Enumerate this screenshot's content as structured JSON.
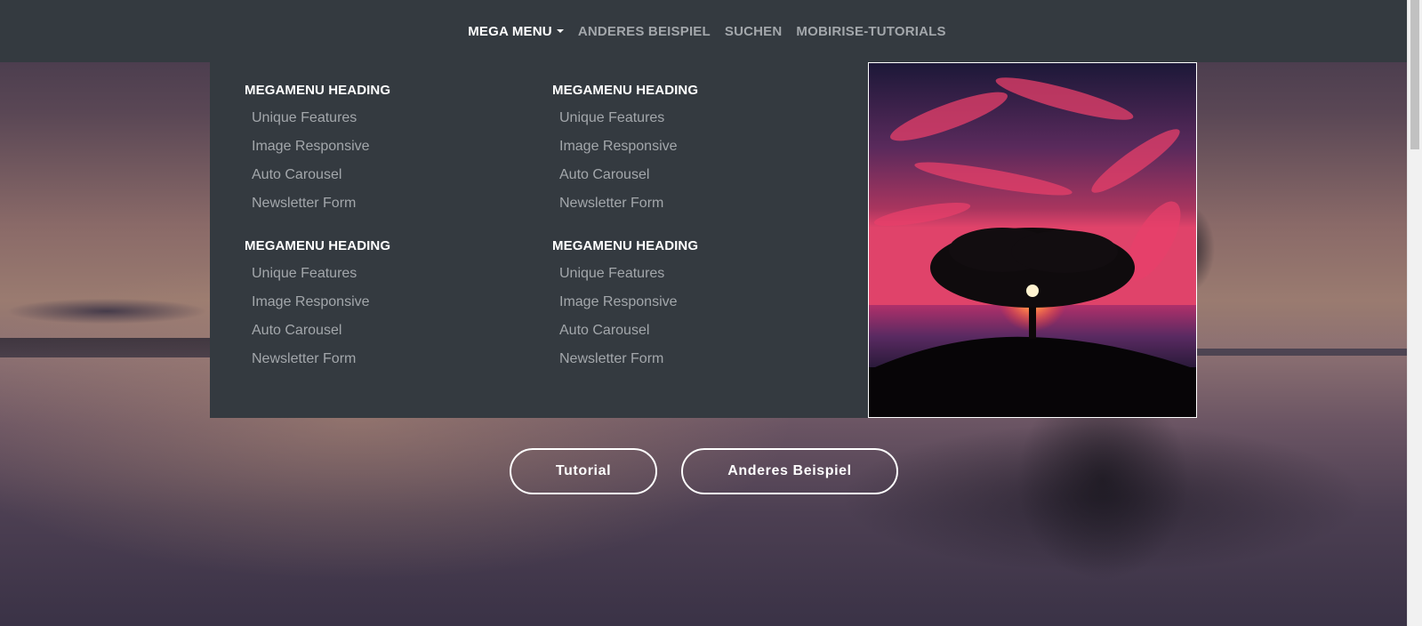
{
  "navbar": {
    "items": [
      {
        "label": "MEGA MENU",
        "active": true
      },
      {
        "label": "ANDERES BEISPIEL",
        "active": false
      },
      {
        "label": "SUCHEN",
        "active": false
      },
      {
        "label": "MOBIRISE-TUTORIALS",
        "active": false
      }
    ]
  },
  "mega_menu": {
    "columns": [
      {
        "sections": [
          {
            "heading": "MEGAMENU HEADING",
            "items": [
              "Unique Features",
              "Image Responsive",
              "Auto Carousel",
              "Newsletter Form"
            ]
          },
          {
            "heading": "MEGAMENU HEADING",
            "items": [
              "Unique Features",
              "Image Responsive",
              "Auto Carousel",
              "Newsletter Form"
            ]
          }
        ]
      },
      {
        "sections": [
          {
            "heading": "MEGAMENU HEADING",
            "items": [
              "Unique Features",
              "Image Responsive",
              "Auto Carousel",
              "Newsletter Form"
            ]
          },
          {
            "heading": "MEGAMENU HEADING",
            "items": [
              "Unique Features",
              "Image Responsive",
              "Auto Carousel",
              "Newsletter Form"
            ]
          }
        ]
      }
    ],
    "image_icon": "tree-sunset-image"
  },
  "hero": {
    "buttons": [
      "Tutorial",
      "Anderes Beispiel"
    ]
  },
  "colors": {
    "navbar_bg": "#343a40",
    "link_muted": "#a3a7ab",
    "link_active": "#ffffff"
  }
}
